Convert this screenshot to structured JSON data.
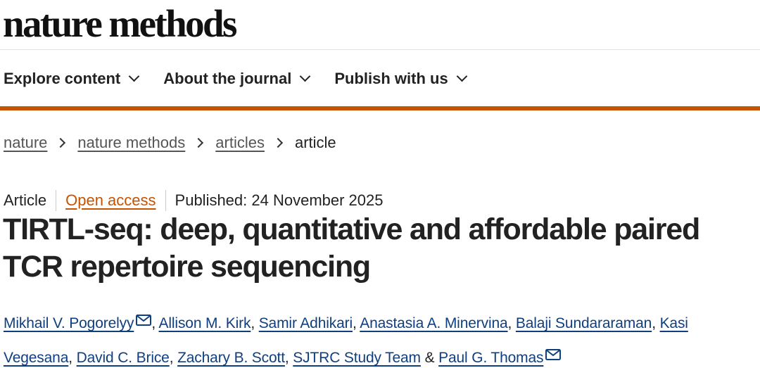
{
  "site": {
    "journal_name": "nature methods"
  },
  "nav": {
    "items": [
      {
        "label": "Explore content"
      },
      {
        "label": "About the journal"
      },
      {
        "label": "Publish with us"
      }
    ]
  },
  "breadcrumb": {
    "items": [
      "nature",
      "nature methods",
      "articles",
      "article"
    ]
  },
  "article": {
    "type": "Article",
    "access": "Open access",
    "published": "Published: 24 November 2025",
    "title": "TIRTL-seq: deep, quantitative and affordable paired TCR repertoire sequencing",
    "authors": [
      {
        "name": "Mikhail V. Pogorelyy",
        "email_icon": "mail-icon"
      },
      {
        "name": "Allison M. Kirk"
      },
      {
        "name": "Samir Adhikari"
      },
      {
        "name": "Anastasia A. Minervina"
      },
      {
        "name": "Balaji Sundararaman"
      },
      {
        "name": "Kasi Vegesana"
      },
      {
        "name": "David C. Brice"
      },
      {
        "name": "Zachary B. Scott"
      },
      {
        "name": "SJTRC Study Team"
      },
      {
        "name": "Paul G. Thomas",
        "email_icon": "mail-icon"
      }
    ],
    "comma": ",",
    "ampersand": "&"
  },
  "colors": {
    "accent_orange": "#c65301",
    "author_link": "#0f3f80",
    "text": "#222222"
  }
}
